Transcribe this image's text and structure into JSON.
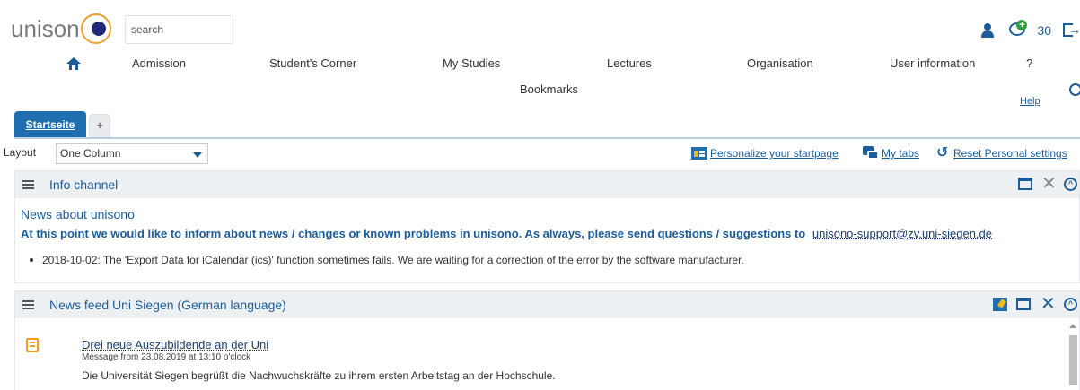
{
  "header": {
    "logo_text": "unison",
    "search_placeholder": "search",
    "message_count": "30"
  },
  "nav": {
    "items": [
      "Admission",
      "Student's Corner",
      "My Studies",
      "Lectures",
      "Organisation",
      "User information",
      "?"
    ],
    "bookmarks": "Bookmarks",
    "help": "Help"
  },
  "tabs": {
    "active": "Startseite",
    "add": "+"
  },
  "layout_bar": {
    "label": "Layout",
    "selected": "One Column",
    "personalize": "Personalize your startpage",
    "my_tabs": "My tabs",
    "reset": "Reset Personal settings"
  },
  "info_channel": {
    "title": "Info channel",
    "news_title": "News about unisono",
    "intro": "At this point we would like to inform about news / changes or known problems in unisono. As always, please send questions / suggestions to",
    "email": "unisono-support@zv.uni-siegen.de",
    "items": [
      "2018-10-02: The 'Export Data for iCalendar (ics)' function sometimes fails. We are waiting for a correction of the error by the software manufacturer."
    ]
  },
  "news_feed": {
    "title": "News feed Uni Siegen (German language)",
    "headline": "Drei neue Auszubildende an der Uni",
    "date": "Message from 23.08.2019 at 13:10 o'clock",
    "text": "Die Universität Siegen begrüßt die Nachwuchskräfte zu ihrem ersten Arbeitstag an der Hochschule."
  },
  "colors": {
    "primary": "#1c5d99",
    "tab_active": "#1f6fb0",
    "logo_ring": "#f0a030",
    "logo_dot": "#1e2a78",
    "accent_green": "#2e9e3e",
    "feed_icon": "#f29b1c"
  }
}
